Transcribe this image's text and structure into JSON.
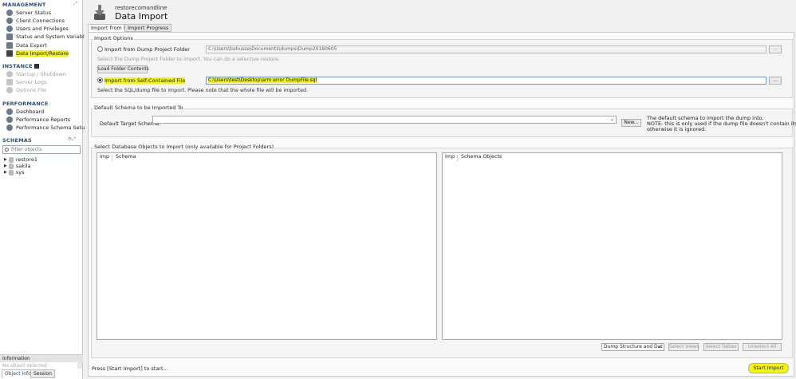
{
  "sidebar": {
    "management_title": "MANAGEMENT",
    "management_items": [
      {
        "label": "Server Status",
        "icon": "server-status-icon"
      },
      {
        "label": "Client Connections",
        "icon": "client-connections-icon"
      },
      {
        "label": "Users and Privileges",
        "icon": "users-icon"
      },
      {
        "label": "Status and System Variables",
        "icon": "variables-icon"
      },
      {
        "label": "Data Export",
        "icon": "export-icon"
      },
      {
        "label": "Data Import/Restore",
        "icon": "import-icon"
      }
    ],
    "instance_title": "INSTANCE",
    "instance_items": [
      {
        "label": "Startup / Shutdown"
      },
      {
        "label": "Server Logs"
      },
      {
        "label": "Options File"
      }
    ],
    "performance_title": "PERFORMANCE",
    "performance_items": [
      {
        "label": "Dashboard"
      },
      {
        "label": "Performance Reports"
      },
      {
        "label": "Performance Schema Setup"
      }
    ],
    "schemas_title": "SCHEMAS",
    "filter_placeholder": "Filter objects",
    "schemas": [
      "restore1",
      "sakila",
      "sys"
    ],
    "info_title": "Information",
    "info_text": "No object selected",
    "bottom_tabs": [
      "Object Info",
      "Session"
    ]
  },
  "header": {
    "connection": "restorecomandline",
    "title": "Data Import"
  },
  "tabs": [
    "Import from Disk",
    "Import Progress"
  ],
  "import_options": {
    "title": "Import Options",
    "folder_label": "Import from Dump Project Folder",
    "folder_path": "C:\\Users\\bahusse\\Documents\\dumps\\Dump20180605",
    "folder_hint": "Select the Dump Project Folder to import. You can do a selective restore.",
    "load_button": "Load Folder Contents",
    "file_label": "Import from Self-Contained File",
    "file_path": "C:\\Users\\test\\Desktop\\arm error DumpFile.sql",
    "file_hint": "Select the SQL/dump file to import. Please note that the whole file will be imported.",
    "browse": "..."
  },
  "default_schema": {
    "title": "Default Schema to be Imported To",
    "label": "Default Target Schema:",
    "new_button": "New...",
    "note_1": "The default schema to import the dump into.",
    "note_2": "NOTE: this is only used if the dump file doesn't contain its schema,",
    "note_3": "otherwise it is ignored."
  },
  "objects": {
    "title": "Select Database Objects to Import (only available for Project Folders)",
    "left_headers": [
      "Imp",
      "Schema"
    ],
    "right_headers": [
      "Imp",
      "Schema Objects"
    ],
    "dump_select": "Dump Structure and Dat",
    "select_views": "Select Views",
    "select_tables": "Select Tables",
    "unselect_all": "Unselect All"
  },
  "footer": {
    "status": "Press [Start Import] to start...",
    "start_button": "Start Import"
  },
  "colors": {
    "highlight": "#f5f50a",
    "section_title": "#2a4f7e"
  }
}
